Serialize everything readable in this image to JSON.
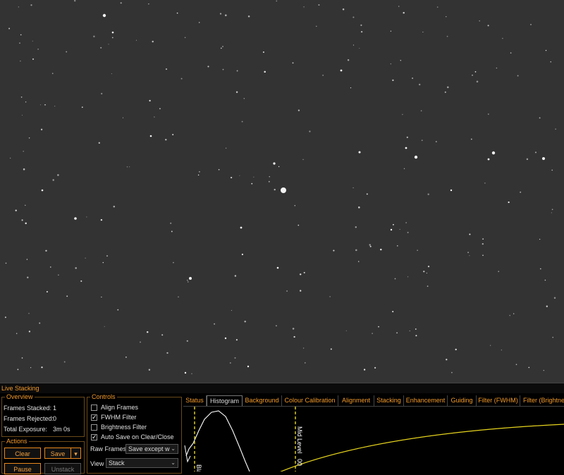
{
  "window": {
    "title": "Live Stacking"
  },
  "overview": {
    "legend": "Overview",
    "frames_stacked_label": "Frames Stacked:",
    "frames_stacked_value": "1",
    "frames_rejected_label": "Frames Rejected:",
    "frames_rejected_value": "0",
    "total_exposure_label": "Total Exposure:",
    "total_exposure_value": "3m 0s"
  },
  "actions": {
    "legend": "Actions",
    "clear": "Clear",
    "save": "Save",
    "pause": "Pause",
    "unstack": "Unstack"
  },
  "controls": {
    "legend": "Controls",
    "align_frames": {
      "label": "Align Frames",
      "checked": false
    },
    "fwhm_filter": {
      "label": "FWHM Filter",
      "checked": true
    },
    "brightness_filter": {
      "label": "Brightness Filter",
      "checked": false
    },
    "auto_save": {
      "label": "Auto Save on Clear/Close",
      "checked": true
    },
    "raw_frames_label": "Raw Frames",
    "raw_frames_value": "Save except w",
    "view_label": "View",
    "view_value": "Stack"
  },
  "tabs": [
    {
      "label": "Status",
      "active": false
    },
    {
      "label": "Histogram",
      "active": true
    },
    {
      "label": "Background",
      "active": false
    },
    {
      "label": "Colour Calibration",
      "active": false
    },
    {
      "label": "Alignment",
      "active": false
    },
    {
      "label": "Stacking",
      "active": false
    },
    {
      "label": "Enhancement",
      "active": false
    },
    {
      "label": "Guiding",
      "active": false
    },
    {
      "label": "Filter (FWHM)",
      "active": false
    },
    {
      "label": "Filter (Brightne",
      "active": false
    }
  ],
  "histogram": {
    "black_label": "Black",
    "mid_label": "Mid Level",
    "mid_value": "00",
    "marker_color": "#f5e61a",
    "curve_color": "#e6d31e",
    "histogram_color": "#ffffff"
  },
  "colors": {
    "accent": "#f39a2a",
    "sky": "#333333"
  }
}
